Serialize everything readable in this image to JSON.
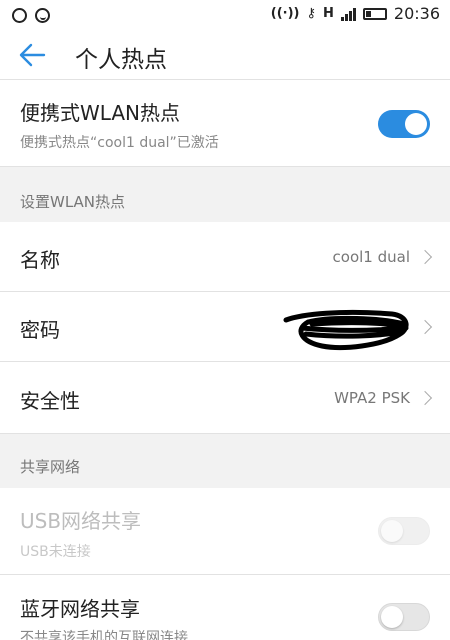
{
  "status_bar": {
    "left_icons": [
      "sync-icon",
      "smiley-icon"
    ],
    "network": "H",
    "time": "20:36"
  },
  "app_bar": {
    "title": "个人热点"
  },
  "hotspot": {
    "label": "便携式WLAN热点",
    "status": "便携式热点“cool1 dual”已激活",
    "enabled": true
  },
  "setup_section": {
    "header": "设置WLAN热点",
    "items": [
      {
        "label": "名称",
        "value": "cool1 dual"
      },
      {
        "label": "密码",
        "value": ""
      },
      {
        "label": "安全性",
        "value": "WPA2 PSK"
      }
    ]
  },
  "share_section": {
    "header": "共享网络",
    "usb": {
      "label": "USB网络共享",
      "status": "USB未连接",
      "enabled": false,
      "disabled": true
    },
    "bluetooth": {
      "label": "蓝牙网络共享",
      "status": "不共享该手机的互联网连接",
      "enabled": false
    }
  },
  "colors": {
    "accent": "#2b8ce0",
    "background": "#f2f2f2"
  }
}
